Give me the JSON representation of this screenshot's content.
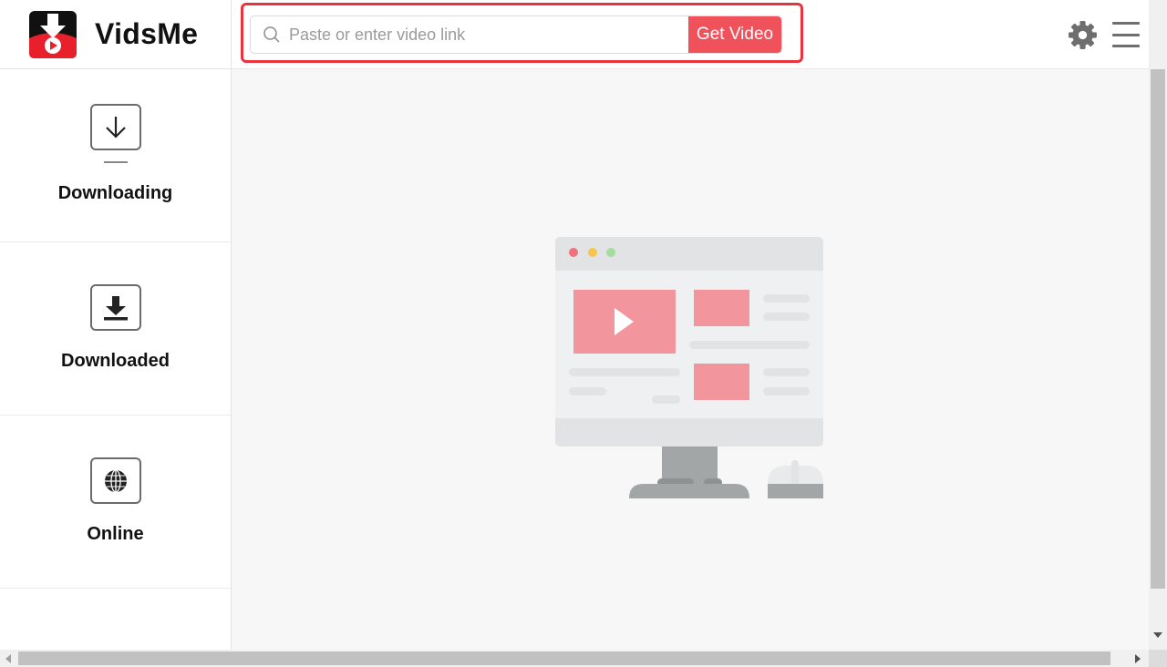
{
  "app": {
    "name": "VidsMe"
  },
  "colors": {
    "accent": "#f0525c",
    "highlight": "#e8353d",
    "icon_gray": "#6e6e6e"
  },
  "sidebar": {
    "items": [
      {
        "label": "Downloading",
        "icon": "download-arrow-icon"
      },
      {
        "label": "Downloaded",
        "icon": "download-tray-icon"
      },
      {
        "label": "Online",
        "icon": "globe-icon"
      }
    ]
  },
  "search": {
    "placeholder": "Paste or enter video link",
    "value": "",
    "button_label": "Get Video"
  },
  "toolbar": {
    "settings_icon": "gear-icon",
    "menu_icon": "hamburger-menu-icon"
  },
  "main": {
    "illustration": "empty-state-monitor-illustration"
  }
}
